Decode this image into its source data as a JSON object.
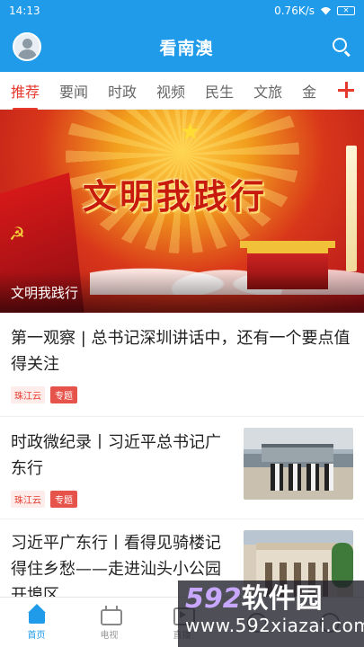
{
  "status_bar": {
    "time": "14:13",
    "network_speed": "0.76K/s"
  },
  "header": {
    "title": "看南澳"
  },
  "tabs": [
    {
      "label": "推荐",
      "active": true
    },
    {
      "label": "要闻"
    },
    {
      "label": "时政"
    },
    {
      "label": "视频"
    },
    {
      "label": "民生"
    },
    {
      "label": "文旅"
    },
    {
      "label": "金"
    }
  ],
  "banner": {
    "headline": "文明我践行",
    "caption": "文明我践行"
  },
  "news": [
    {
      "title": "第一观察 | 总书记深圳讲话中，还有一个要点值得关注",
      "source": "珠江云",
      "tag": "专题"
    },
    {
      "title": "时政微纪录丨习近平总书记广东行",
      "source": "珠江云",
      "tag": "专题"
    },
    {
      "title": "习近平广东行丨看得见骑楼记得住乡愁——走进汕头小公园开埠区"
    }
  ],
  "bottom_nav": [
    {
      "label": "首页",
      "active": true
    },
    {
      "label": "电视"
    },
    {
      "label": "直播"
    },
    {
      "label": ""
    },
    {
      "label": ""
    }
  ],
  "watermark": {
    "logo_num": "592",
    "logo_text": "软件园",
    "url": "www.592xiazai.com"
  },
  "colors": {
    "brand_blue": "#1f9be9",
    "accent_red": "#e63a2e"
  }
}
